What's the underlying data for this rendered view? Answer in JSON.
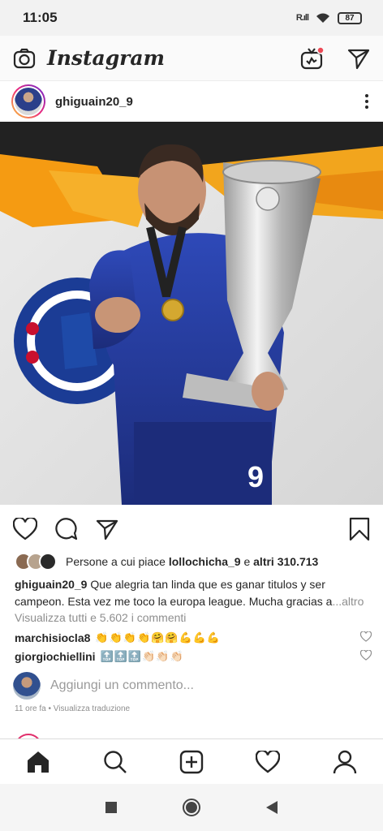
{
  "status_bar": {
    "time": "11:05",
    "signal": "R.ıll",
    "battery": "87"
  },
  "header": {
    "logo": "Instagram",
    "camera_icon": "camera-icon",
    "igtv_icon": "igtv-icon",
    "direct_icon": "paper-plane-icon"
  },
  "post": {
    "username": "ghiguain20_9",
    "likes": {
      "prefix": "Persone a cui piace ",
      "first_user": "lollochicha_9",
      "connector": " e ",
      "others": "altri 310.713"
    },
    "caption": {
      "username": "ghiguain20_9",
      "text": " Que alegria tan linda que es ganar titulos y ser campeon. Esta vez me toco la europa league. Mucha gracias a",
      "more": "...altro"
    },
    "view_comments": "Visualizza tutti e 5.602 i commenti",
    "comments": [
      {
        "username": "marchisiocla8",
        "text": "👏👏👏👏🤗🤗💪💪💪"
      },
      {
        "username": "giorgiochiellini",
        "text": "🔝🔝🔝👏🏻👏🏻👏🏻"
      }
    ],
    "add_comment_placeholder": "Aggiungi un commento...",
    "time": "11 ore fa",
    "separator": " • ",
    "translate": "Visualizza traduzione"
  },
  "bottom_nav": [
    "home-icon",
    "search-icon",
    "add-post-icon",
    "activity-heart-icon",
    "profile-icon"
  ],
  "android_nav": [
    "recents-square-icon",
    "home-circle-icon",
    "back-triangle-icon"
  ],
  "colors": {
    "notification_dot": "#ed4956",
    "link_gray": "#8e8e8e",
    "text": "#262626"
  }
}
